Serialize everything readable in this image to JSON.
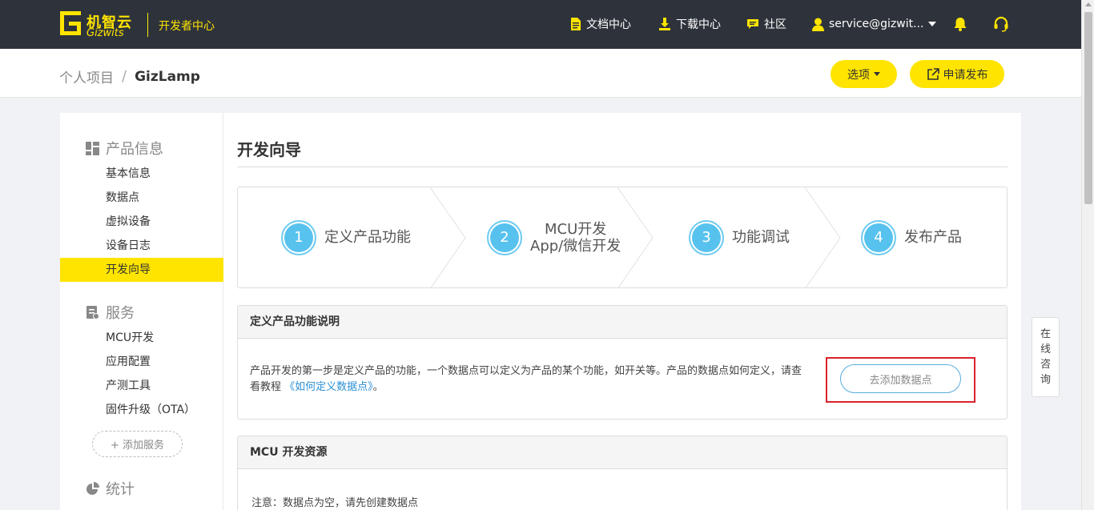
{
  "topbar": {
    "logo_cn": "机智云",
    "logo_en": "Gizwits",
    "section": "开发者中心",
    "nav": {
      "docs": "文档中心",
      "download": "下载中心",
      "community": "社区",
      "user": "service@gizwit..."
    }
  },
  "header": {
    "breadcrumb_parent": "个人项目",
    "breadcrumb_sep": "/",
    "breadcrumb_current": "GizLamp",
    "options_label": "选项",
    "publish_label": "申请发布"
  },
  "sidebar": {
    "product_title": "产品信息",
    "product_items": [
      "基本信息",
      "数据点",
      "虚拟设备",
      "设备日志",
      "开发向导"
    ],
    "active_item": "开发向导",
    "service_title": "服务",
    "service_items": [
      "MCU开发",
      "应用配置",
      "产测工具",
      "固件升级（OTA）"
    ],
    "add_service": "+ 添加服务",
    "stats_title": "统计"
  },
  "main": {
    "title": "开发向导",
    "steps": [
      {
        "num": "1",
        "label": "定义产品功能"
      },
      {
        "num": "2",
        "label_line1": "MCU开发",
        "label_line2": "App/微信开发"
      },
      {
        "num": "3",
        "label": "功能调试"
      },
      {
        "num": "4",
        "label": "发布产品"
      }
    ],
    "card1": {
      "heading": "定义产品功能说明",
      "text_before": "产品开发的第一步是定义产品的功能，一个数据点可以定义为产品的某个功能，如开关等。产品的数据点如何定义，请查看教程 ",
      "link": "《如何定义数据点》",
      "text_after": "。",
      "button": "去添加数据点"
    },
    "card2": {
      "heading": "MCU 开发资源",
      "note": "注意：数据点为空，请先创建数据点"
    }
  },
  "consult": [
    "在",
    "线",
    "咨",
    "询"
  ],
  "colors": {
    "accent": "#ffe400",
    "topbar": "#2e333b",
    "step_blue": "#57c2ee",
    "link": "#2a8fd4",
    "highlight": "#d9232d"
  }
}
